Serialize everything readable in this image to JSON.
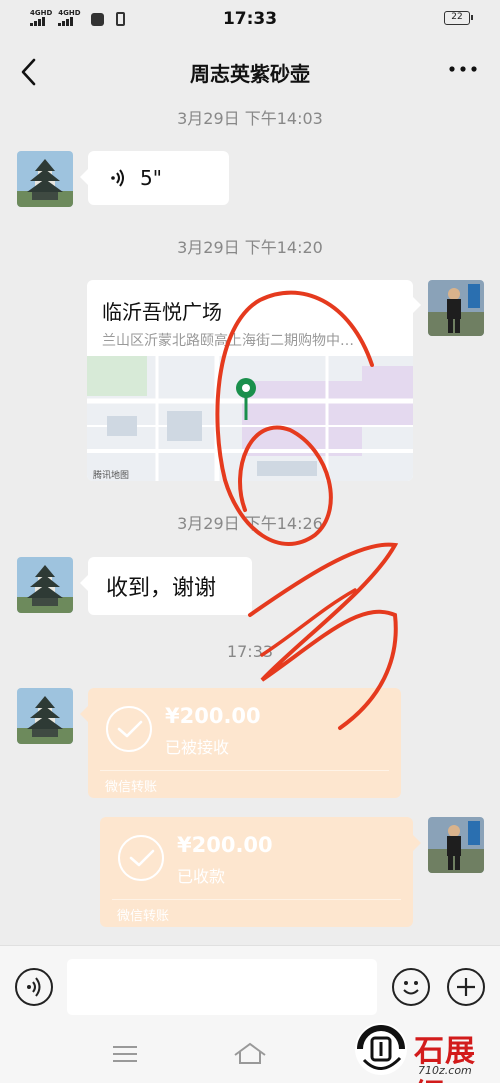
{
  "status_bar": {
    "signal1_label": "4GHD",
    "signal2_label": "4GHD",
    "time": "17:33",
    "battery": "22"
  },
  "header": {
    "title": "周志英紫砂壶",
    "back_icon": "chevron-left-icon",
    "more_icon": "more-dots-icon"
  },
  "messages": {
    "ts1": "3月29日 下午14:03",
    "voice_duration": "5\"",
    "ts2": "3月29日 下午14:20",
    "location_title": "临沂吾悦广场",
    "location_address": "兰山区沂蒙北路颐高上海街二期购物中…",
    "map_attribution": "腾讯地图",
    "ts3": "3月29日 下午14:26",
    "text_reply": "收到，谢谢",
    "ts4": "17:33",
    "transfer1": {
      "amount": "¥200.00",
      "status": "已被接收",
      "label": "微信转账"
    },
    "transfer2": {
      "amount": "¥200.00",
      "status": "已收款",
      "label": "微信转账"
    }
  },
  "watermark": {
    "brand": "石展網",
    "url": "710z.com"
  },
  "colors": {
    "background": "#ededed",
    "transfer_bubble": "#fde6cf",
    "map_pin": "#1a8f4c",
    "scribble": "#e53a1e"
  }
}
